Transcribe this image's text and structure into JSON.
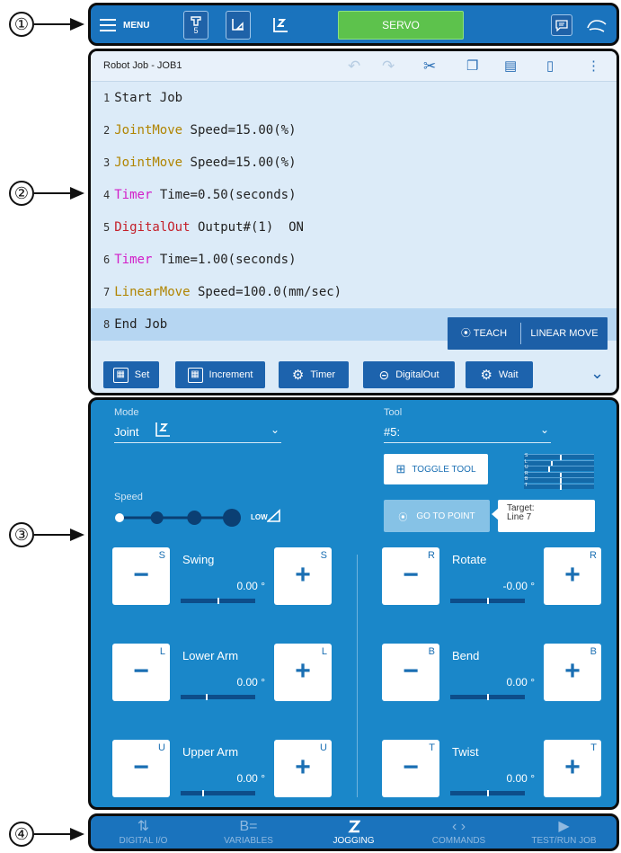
{
  "callouts": [
    "①",
    "②",
    "③",
    "④"
  ],
  "topbar": {
    "menu_label": "MENU",
    "tool_badge": "5",
    "servo_label": "SERVO",
    "icons": [
      "hamburger-icon",
      "robot-tool-icon",
      "coordinate-frame-icon",
      "joint-frame-icon",
      "message-icon",
      "teach-pendant-hand-icon"
    ]
  },
  "job": {
    "title": "Robot Job - JOB1",
    "toolbar_icons": [
      "undo-icon",
      "redo-icon",
      "cut-icon",
      "copy-icon",
      "paste-icon",
      "delete-icon",
      "more-icon"
    ],
    "lines": [
      {
        "num": "1",
        "keyword": "",
        "kind": "",
        "rest": "Start Job"
      },
      {
        "num": "2",
        "keyword": "JointMove",
        "kind": "joint",
        "rest": " Speed=15.00(%)"
      },
      {
        "num": "3",
        "keyword": "JointMove",
        "kind": "joint",
        "rest": " Speed=15.00(%)"
      },
      {
        "num": "4",
        "keyword": "Timer",
        "kind": "timer",
        "rest": " Time=0.50(seconds)"
      },
      {
        "num": "5",
        "keyword": "DigitalOut",
        "kind": "dout",
        "rest": " Output#(1)  ON"
      },
      {
        "num": "6",
        "keyword": "Timer",
        "kind": "timer",
        "rest": " Time=1.00(seconds)"
      },
      {
        "num": "7",
        "keyword": "LinearMove",
        "kind": "linear",
        "rest": " Speed=100.0(mm/sec)"
      },
      {
        "num": "8",
        "keyword": "",
        "kind": "",
        "rest": "End Job"
      }
    ],
    "selected_line": "8",
    "teach_label": "TEACH",
    "linear_move_label": "LINEAR MOVE",
    "commands": [
      "Set",
      "Increment",
      "Timer",
      "DigitalOut",
      "Wait"
    ]
  },
  "jog": {
    "mode_label": "Mode",
    "mode_value": "Joint",
    "tool_label": "Tool",
    "tool_value": "#5:",
    "toggle_tool_label": "TOGGLE TOOL",
    "speed_label": "Speed",
    "speed_level": "LOW",
    "speed_steps": 4,
    "speed_selected": 4,
    "goto_label": "GO TO POINT",
    "target_label": "Target:",
    "target_value": "Line 7",
    "mini_axes": [
      "S",
      "L",
      "U",
      "R",
      "B",
      "T"
    ],
    "axes": [
      {
        "axis": "S",
        "name": "Swing",
        "value": "0.00 °",
        "pos": 0.5
      },
      {
        "axis": "L",
        "name": "Lower Arm",
        "value": "0.00 °",
        "pos": 0.35
      },
      {
        "axis": "U",
        "name": "Upper Arm",
        "value": "0.00 °",
        "pos": 0.3
      },
      {
        "axis": "R",
        "name": "Rotate",
        "value": "-0.00 °",
        "pos": 0.5
      },
      {
        "axis": "B",
        "name": "Bend",
        "value": "0.00 °",
        "pos": 0.5
      },
      {
        "axis": "T",
        "name": "Twist",
        "value": "0.00 °",
        "pos": 0.5
      }
    ]
  },
  "nav": {
    "items": [
      {
        "label": "DIGITAL I/O",
        "icon": "digital-io-icon"
      },
      {
        "label": "VARIABLES",
        "icon": "variables-icon"
      },
      {
        "label": "JOGGING",
        "icon": "jogging-icon"
      },
      {
        "label": "COMMANDS",
        "icon": "commands-icon"
      },
      {
        "label": "TEST/RUN JOB",
        "icon": "play-icon"
      }
    ],
    "active": "JOGGING"
  }
}
